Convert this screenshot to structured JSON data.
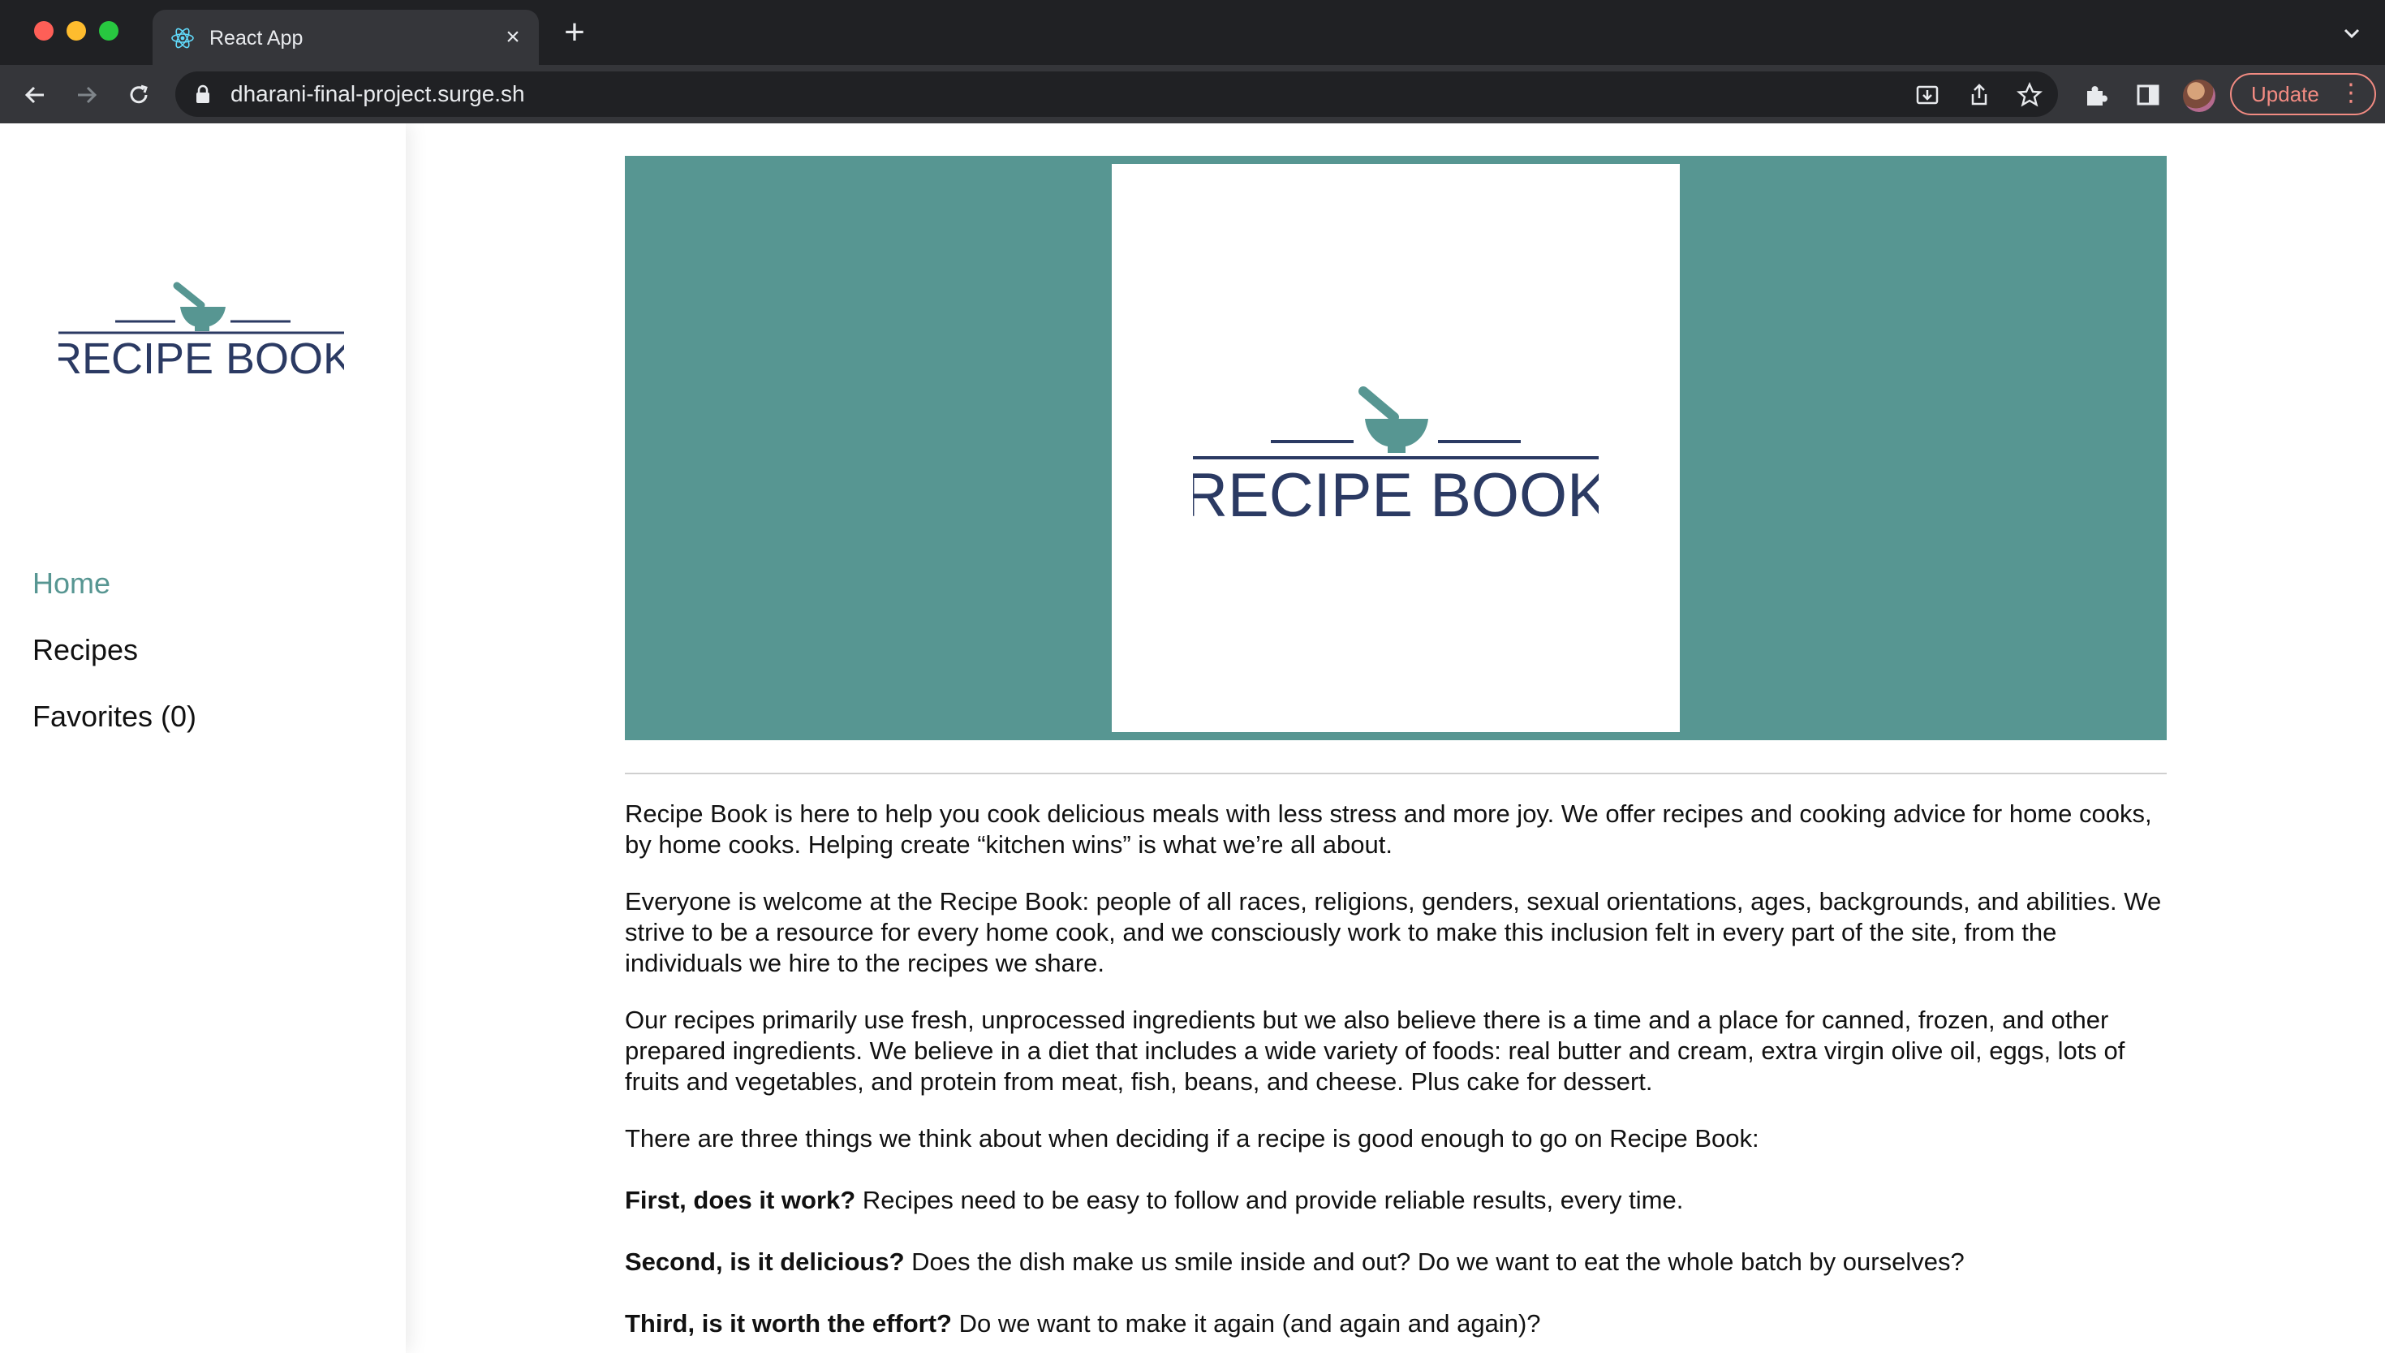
{
  "browser": {
    "tab_title": "React App",
    "url": "dharani-final-project.surge.sh",
    "update_label": "Update"
  },
  "sidebar": {
    "logo_text": "RECIPE BOOK",
    "nav": [
      {
        "label": "Home",
        "active": true
      },
      {
        "label": "Recipes",
        "active": false
      },
      {
        "label": "Favorites (0)",
        "active": false
      }
    ]
  },
  "hero": {
    "logo_text": "RECIPE BOOK",
    "background_color": "#579692"
  },
  "content": {
    "p1": "Recipe Book is here to help you cook delicious meals with less stress and more joy. We offer recipes and cooking advice for home cooks, by home cooks. Helping create “kitchen wins” is what we’re all about.",
    "p2": "Everyone is welcome at the Recipe Book: people of all races, religions, genders, sexual orientations, ages, backgrounds, and abilities. We strive to be a resource for every home cook, and we consciously work to make this inclusion felt in every part of the site, from the individuals we hire to the recipes we share.",
    "p3": "Our recipes primarily use fresh, unprocessed ingredients but we also believe there is a time and a place for canned, frozen, and other prepared ingredients. We believe in a diet that includes a wide variety of foods: real butter and cream, extra virgin olive oil, eggs, lots of fruits and vegetables, and protein from meat, fish, beans, and cheese. Plus cake for dessert.",
    "p4": "There are three things we think about when deciding if a recipe is good enough to go on Recipe Book:",
    "q1_bold": "First, does it work?",
    "q1_text": " Recipes need to be easy to follow and provide reliable results, every time.",
    "q2_bold": "Second, is it delicious?",
    "q2_text": " Does the dish make us smile inside and out? Do we want to eat the whole batch by ourselves?",
    "q3_bold": "Third, is it worth the effort?",
    "q3_text": " Do we want to make it again (and again and again)?"
  },
  "colors": {
    "accent": "#579692",
    "logo_navy": "#2b3a63"
  }
}
